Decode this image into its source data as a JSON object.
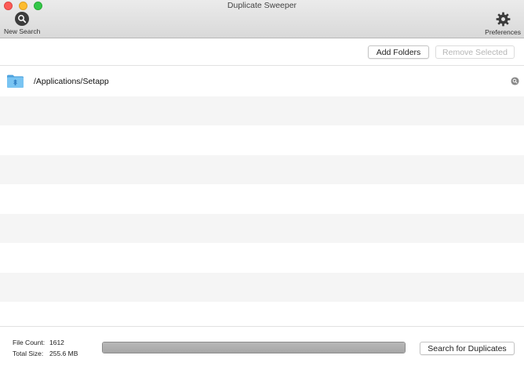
{
  "window": {
    "title": "Duplicate Sweeper"
  },
  "toolbar": {
    "new_search_label": "New Search",
    "new_search_icon": "magnifier-icon",
    "preferences_label": "Preferences",
    "preferences_icon": "gear-icon"
  },
  "actions": {
    "add_folders_label": "Add Folders",
    "remove_selected_label": "Remove Selected",
    "remove_selected_enabled": false
  },
  "folders": [
    {
      "path": "/Applications/Setapp",
      "icon": "setapp-folder-icon"
    }
  ],
  "footer": {
    "file_count_label": "File Count:",
    "file_count_value": "1612",
    "total_size_label": "Total Size:",
    "total_size_value": "255.6 MB",
    "progress_fraction": 1.0,
    "search_button_label": "Search for Duplicates"
  },
  "colors": {
    "close": "#fc5b57",
    "minimize": "#fdbc2e",
    "maximize": "#33c748",
    "folder_blue": "#5fb4ea"
  }
}
